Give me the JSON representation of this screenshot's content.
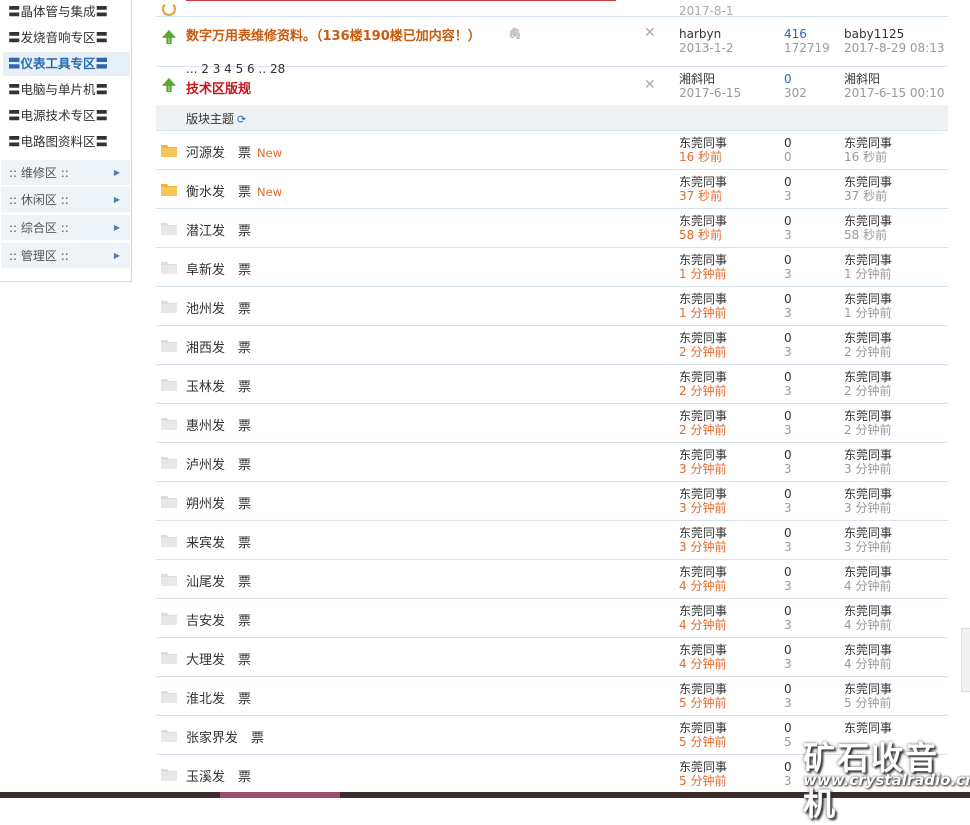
{
  "sidebar": {
    "items": [
      {
        "label": "〓晶体管与集成〓"
      },
      {
        "label": "〓发烧音响专区〓"
      },
      {
        "label": "〓仪表工具专区〓"
      },
      {
        "label": "〓电脑与单片机〓"
      },
      {
        "label": "〓电源技术专区〓"
      },
      {
        "label": "〓电路图资料区〓"
      }
    ],
    "groups": [
      {
        "label": ":: 维修区 ::"
      },
      {
        "label": ":: 休闲区 ::"
      },
      {
        "label": ":: 综合区 ::"
      },
      {
        "label": ":: 管理区 ::"
      }
    ]
  },
  "pinned": [
    {
      "title": "数字万用表维修资料。（136楼190楼已加内容！）",
      "pages": "... 2  3  4  5  6 .. 28",
      "author": "harbyn",
      "date": "2013-1-2",
      "replies": "416",
      "views": "172719",
      "last_user": "baby1125",
      "last_time": "2017-8-29 08:13"
    },
    {
      "title": "技术区版规",
      "author": "湘斜阳",
      "date": "2017-6-15",
      "replies": "0",
      "views": "302",
      "last_user": "湘斜阳",
      "last_time": "2017-6-15 00:10"
    }
  ],
  "partial_top": {
    "date": "2017-8-1"
  },
  "section_label": "版块主题",
  "threads": [
    {
      "title": "河源发　票",
      "new": "New",
      "author": "东莞同事",
      "time": "16 秒前",
      "replies": "0",
      "views": "0",
      "last_user": "东莞同事",
      "last_time": "16 秒前",
      "folder": "new"
    },
    {
      "title": "衡水发　票",
      "new": "New",
      "author": "东莞同事",
      "time": "37 秒前",
      "replies": "0",
      "views": "3",
      "last_user": "东莞同事",
      "last_time": "37 秒前",
      "folder": "new"
    },
    {
      "title": "潜江发　票",
      "author": "东莞同事",
      "time": "58 秒前",
      "replies": "0",
      "views": "3",
      "last_user": "东莞同事",
      "last_time": "58 秒前",
      "folder": "old"
    },
    {
      "title": "阜新发　票",
      "author": "东莞同事",
      "time": "1 分钟前",
      "replies": "0",
      "views": "3",
      "last_user": "东莞同事",
      "last_time": "1 分钟前",
      "folder": "old"
    },
    {
      "title": "池州发　票",
      "author": "东莞同事",
      "time": "1 分钟前",
      "replies": "0",
      "views": "3",
      "last_user": "东莞同事",
      "last_time": "1 分钟前",
      "folder": "old"
    },
    {
      "title": "湘西发　票",
      "author": "东莞同事",
      "time": "2 分钟前",
      "replies": "0",
      "views": "3",
      "last_user": "东莞同事",
      "last_time": "2 分钟前",
      "folder": "old"
    },
    {
      "title": "玉林发　票",
      "author": "东莞同事",
      "time": "2 分钟前",
      "replies": "0",
      "views": "3",
      "last_user": "东莞同事",
      "last_time": "2 分钟前",
      "folder": "old"
    },
    {
      "title": "惠州发　票",
      "author": "东莞同事",
      "time": "2 分钟前",
      "replies": "0",
      "views": "3",
      "last_user": "东莞同事",
      "last_time": "2 分钟前",
      "folder": "old"
    },
    {
      "title": "泸州发　票",
      "author": "东莞同事",
      "time": "3 分钟前",
      "replies": "0",
      "views": "3",
      "last_user": "东莞同事",
      "last_time": "3 分钟前",
      "folder": "old"
    },
    {
      "title": "朔州发　票",
      "author": "东莞同事",
      "time": "3 分钟前",
      "replies": "0",
      "views": "3",
      "last_user": "东莞同事",
      "last_time": "3 分钟前",
      "folder": "old"
    },
    {
      "title": "来宾发　票",
      "author": "东莞同事",
      "time": "3 分钟前",
      "replies": "0",
      "views": "3",
      "last_user": "东莞同事",
      "last_time": "3 分钟前",
      "folder": "old"
    },
    {
      "title": "汕尾发　票",
      "author": "东莞同事",
      "time": "4 分钟前",
      "replies": "0",
      "views": "3",
      "last_user": "东莞同事",
      "last_time": "4 分钟前",
      "folder": "old"
    },
    {
      "title": "吉安发　票",
      "author": "东莞同事",
      "time": "4 分钟前",
      "replies": "0",
      "views": "3",
      "last_user": "东莞同事",
      "last_time": "4 分钟前",
      "folder": "old"
    },
    {
      "title": "大理发　票",
      "author": "东莞同事",
      "time": "4 分钟前",
      "replies": "0",
      "views": "3",
      "last_user": "东莞同事",
      "last_time": "4 分钟前",
      "folder": "old"
    },
    {
      "title": "淮北发　票",
      "author": "东莞同事",
      "time": "5 分钟前",
      "replies": "0",
      "views": "3",
      "last_user": "东莞同事",
      "last_time": "5 分钟前",
      "folder": "old"
    },
    {
      "title": "张家界发　票",
      "author": "东莞同事",
      "time": "5 分钟前",
      "replies": "0",
      "views": "5",
      "last_user": "东莞同事",
      "last_time": "",
      "folder": "old"
    },
    {
      "title": "玉溪发　票",
      "author": "东莞同事",
      "time": "5 分钟前",
      "replies": "0",
      "views": "3",
      "last_user": "",
      "last_time": "",
      "folder": "old"
    }
  ],
  "watermark": {
    "big": "矿石收音机",
    "small": "www.crystalradio.cn"
  },
  "colors": {
    "accent": "#2b6ab0",
    "time_orange": "#e26a2c",
    "pinned_title": "#c85b10",
    "rule_title": "#c8141e",
    "folder_new": "#f5b335",
    "arrow_green": "#5aa832"
  }
}
